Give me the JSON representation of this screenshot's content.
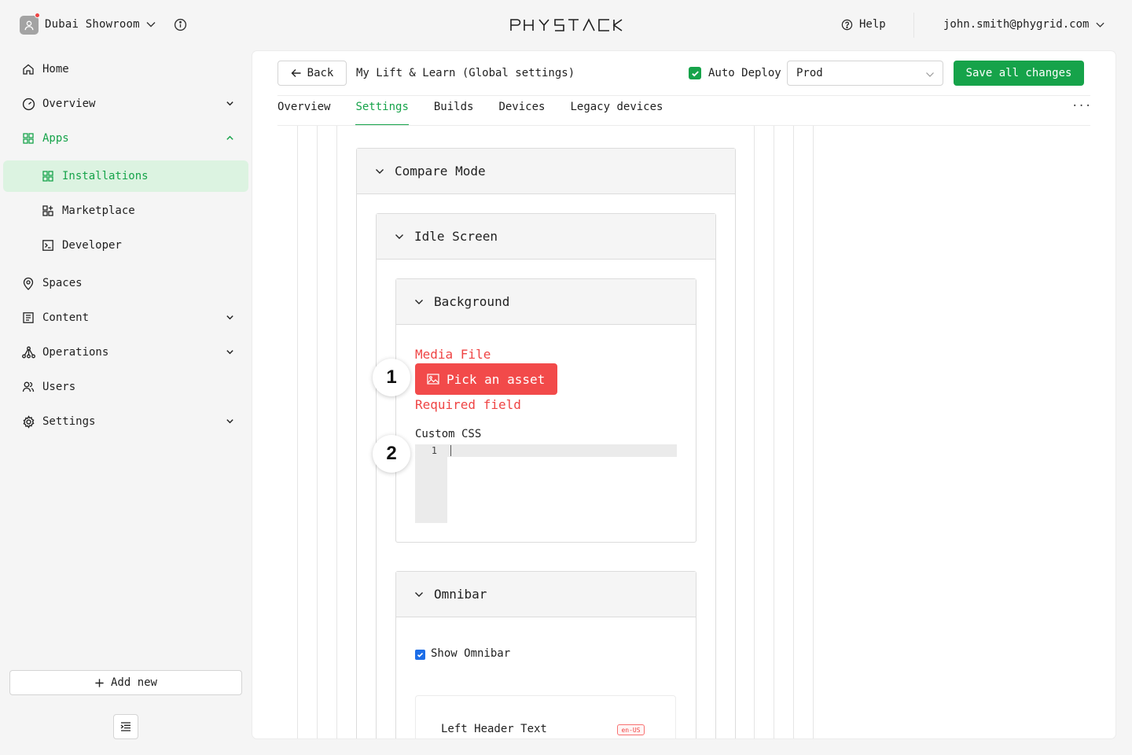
{
  "workspace": {
    "name": "Dubai Showroom"
  },
  "brand": {
    "logo_text": "PHYSTACK",
    "accent": "#16a34a",
    "error": "#ef4444"
  },
  "header": {
    "help_label": "Help",
    "user_email": "john.smith@phygrid.com"
  },
  "sidebar": {
    "items": [
      {
        "label": "Home",
        "icon": "home-icon"
      },
      {
        "label": "Overview",
        "icon": "gauge-icon"
      },
      {
        "label": "Apps",
        "icon": "grid-icon"
      },
      {
        "label": "Installations",
        "icon": "grid-icon"
      },
      {
        "label": "Marketplace",
        "icon": "grid-plus-icon"
      },
      {
        "label": "Developer",
        "icon": "terminal-icon"
      },
      {
        "label": "Spaces",
        "icon": "location-pin-icon"
      },
      {
        "label": "Content",
        "icon": "document-icon"
      },
      {
        "label": "Operations",
        "icon": "network-icon"
      },
      {
        "label": "Users",
        "icon": "users-icon"
      },
      {
        "label": "Settings",
        "icon": "gear-icon"
      }
    ],
    "add_new_label": "Add new"
  },
  "page": {
    "back_label": "Back",
    "title": "My Lift & Learn (Global settings)",
    "auto_deploy_label": "Auto Deploy",
    "auto_deploy_checked": true,
    "environment": "Prod",
    "save_label": "Save all changes",
    "more_label": "···"
  },
  "tabs": [
    "Overview",
    "Settings",
    "Builds",
    "Devices",
    "Legacy devices"
  ],
  "active_tab": "Settings",
  "settings": {
    "compare_mode_title": "Compare Mode",
    "idle_screen_title": "Idle Screen",
    "background_title": "Background",
    "media_file_label": "Media File",
    "pick_asset_label": "Pick an asset",
    "required_error": "Required field",
    "custom_css_label": "Custom CSS",
    "code_line_number": "1",
    "omnibar_title": "Omnibar",
    "show_omnibar_label": "Show Omnibar",
    "show_omnibar_checked": true,
    "left_header_text_label": "Left Header Text",
    "locale_badge": "en-US"
  },
  "step_markers": [
    "1",
    "2"
  ]
}
